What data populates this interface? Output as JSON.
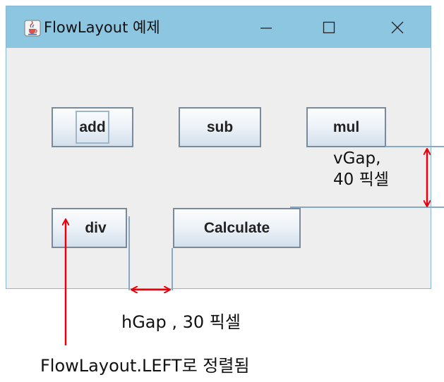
{
  "window": {
    "title": "FlowLayout 예제",
    "icon": "java-cup-icon",
    "controls": [
      "minimize-icon",
      "maximize-icon",
      "close-icon"
    ]
  },
  "buttons": {
    "add": "add",
    "sub": "sub",
    "mul": "mul",
    "div": "div",
    "calculate": "Calculate"
  },
  "annotations": {
    "vgap_line1": "vGap,",
    "vgap_line2": "40 픽셀",
    "hgap": "hGap , 30 픽셀",
    "align": "FlowLayout.LEFT로 정렬됨"
  },
  "colors": {
    "titlebar": "#8dc6e0",
    "window_bg": "#eeeeee",
    "arrow": "#e8000b",
    "guide": "#86aac6"
  }
}
